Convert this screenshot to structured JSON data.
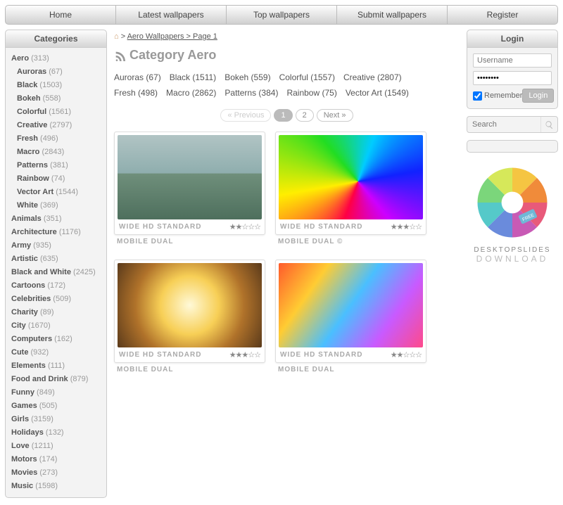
{
  "nav": [
    "Home",
    "Latest wallpapers",
    "Top wallpapers",
    "Submit wallpapers",
    "Register"
  ],
  "sidebar": {
    "title": "Categories",
    "items": [
      {
        "name": "Aero",
        "count": 313
      },
      {
        "name": "Auroras",
        "count": 67,
        "indent": 1
      },
      {
        "name": "Black",
        "count": 1503,
        "indent": 1
      },
      {
        "name": "Bokeh",
        "count": 558,
        "indent": 1
      },
      {
        "name": "Colorful",
        "count": 1561,
        "indent": 1
      },
      {
        "name": "Creative",
        "count": 2797,
        "indent": 1
      },
      {
        "name": "Fresh",
        "count": 496,
        "indent": 1
      },
      {
        "name": "Macro",
        "count": 2843,
        "indent": 1
      },
      {
        "name": "Patterns",
        "count": 381,
        "indent": 1
      },
      {
        "name": "Rainbow",
        "count": 74,
        "indent": 1
      },
      {
        "name": "Vector Art",
        "count": 1544,
        "indent": 1
      },
      {
        "name": "White",
        "count": 369,
        "indent": 1
      },
      {
        "name": "Animals",
        "count": 351
      },
      {
        "name": "Architecture",
        "count": 1176
      },
      {
        "name": "Army",
        "count": 935
      },
      {
        "name": "Artistic",
        "count": 635
      },
      {
        "name": "Black and White",
        "count": 2425
      },
      {
        "name": "Cartoons",
        "count": 172
      },
      {
        "name": "Celebrities",
        "count": 509
      },
      {
        "name": "Charity",
        "count": 89
      },
      {
        "name": "City",
        "count": 1670
      },
      {
        "name": "Computers",
        "count": 162
      },
      {
        "name": "Cute",
        "count": 932
      },
      {
        "name": "Elements",
        "count": 111
      },
      {
        "name": "Food and Drink",
        "count": 879
      },
      {
        "name": "Funny",
        "count": 849
      },
      {
        "name": "Games",
        "count": 505
      },
      {
        "name": "Girls",
        "count": 3159
      },
      {
        "name": "Holidays",
        "count": 132
      },
      {
        "name": "Love",
        "count": 1211
      },
      {
        "name": "Motors",
        "count": 174
      },
      {
        "name": "Movies",
        "count": 273
      },
      {
        "name": "Music",
        "count": 1598
      }
    ]
  },
  "breadcrumb": {
    "text": "Aero Wallpapers > Page 1"
  },
  "heading": "Category Aero",
  "subcats": [
    {
      "name": "Auroras",
      "count": 67
    },
    {
      "name": "Black",
      "count": 1511
    },
    {
      "name": "Bokeh",
      "count": 559
    },
    {
      "name": "Colorful",
      "count": 1557
    },
    {
      "name": "Creative",
      "count": 2807
    },
    {
      "name": "Fresh",
      "count": 498
    },
    {
      "name": "Macro",
      "count": 2862
    },
    {
      "name": "Patterns",
      "count": 384
    },
    {
      "name": "Rainbow",
      "count": 75
    },
    {
      "name": "Vector Art",
      "count": 1549
    }
  ],
  "pager": {
    "prev": "« Previous",
    "pages": [
      "1",
      "2"
    ],
    "next": "Next »",
    "current": "1"
  },
  "cards": [
    {
      "bg": "bg1",
      "tag": "WIDE HD STANDARD",
      "stars": "★★☆☆☆",
      "meta": "MOBILE DUAL"
    },
    {
      "bg": "bg2",
      "tag": "WIDE HD STANDARD",
      "stars": "★★★☆☆",
      "meta": "MOBILE DUAL ©"
    },
    {
      "bg": "bg3",
      "tag": "WIDE HD STANDARD",
      "stars": "★★★☆☆",
      "meta": "MOBILE DUAL"
    },
    {
      "bg": "bg4",
      "tag": "WIDE HD STANDARD",
      "stars": "★★☆☆☆",
      "meta": "MOBILE DUAL"
    }
  ],
  "login": {
    "title": "Login",
    "user_ph": "Username",
    "pass_value": "········",
    "remember": "Remember",
    "btn": "Login"
  },
  "search": {
    "ph": "Search"
  },
  "promo": {
    "line1": "DESKTOPSLIDES",
    "line2": "DOWNLOAD",
    "badge": "FREE"
  }
}
